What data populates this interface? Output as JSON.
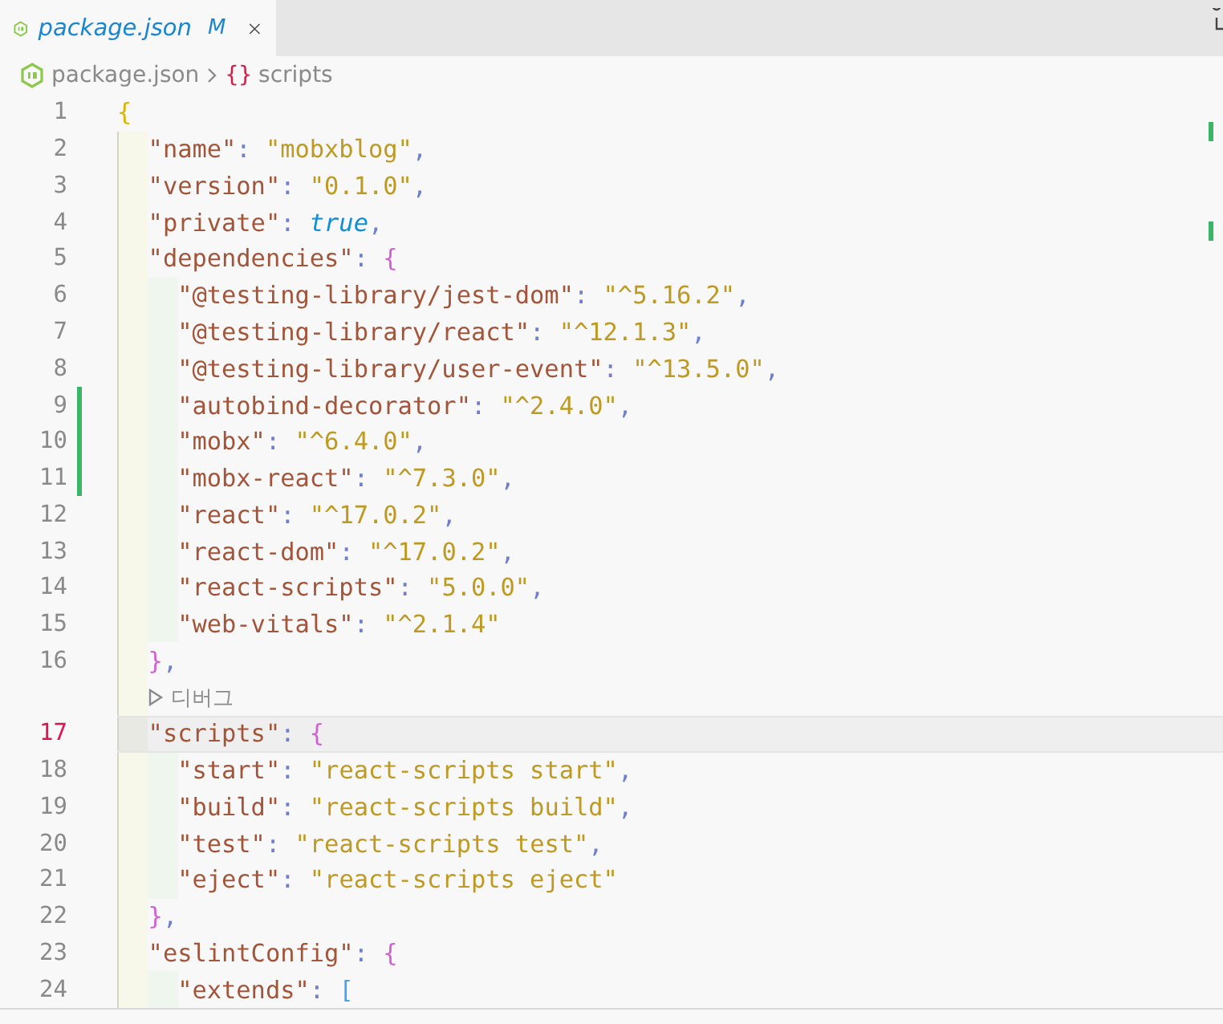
{
  "tab": {
    "title": "package.json",
    "badge": "M",
    "selected": true
  },
  "breadcrumb": {
    "file": "package.json",
    "symbol": "{}",
    "section": "scripts"
  },
  "lines": [
    {
      "kind": "code",
      "number": "1",
      "selected": false,
      "modified": false,
      "tokens": [
        {
          "kind": "bracket",
          "text": "{",
          "color": "#d9b400"
        }
      ],
      "children": [
        {
          "kind": "code",
          "number": "2",
          "selected": false,
          "modified": false,
          "tokens": [
            {
              "kind": "key",
              "text": "\"name\""
            },
            {
              "kind": "punct",
              "text": ": "
            },
            {
              "kind": "string",
              "text": "\"mobxblog\""
            },
            {
              "kind": "punct",
              "text": ","
            }
          ]
        },
        {
          "kind": "code",
          "number": "3",
          "selected": false,
          "modified": false,
          "tokens": [
            {
              "kind": "key",
              "text": "\"version\""
            },
            {
              "kind": "punct",
              "text": ": "
            },
            {
              "kind": "string",
              "text": "\"0.1.0\""
            },
            {
              "kind": "punct",
              "text": ","
            }
          ]
        },
        {
          "kind": "code",
          "number": "4",
          "selected": false,
          "modified": false,
          "tokens": [
            {
              "kind": "key",
              "text": "\"private\""
            },
            {
              "kind": "punct",
              "text": ": "
            },
            {
              "kind": "keyword",
              "text": "true"
            },
            {
              "kind": "punct",
              "text": ","
            }
          ]
        },
        {
          "kind": "code",
          "number": "5",
          "selected": false,
          "modified": false,
          "tokens": [
            {
              "kind": "key",
              "text": "\"dependencies\""
            },
            {
              "kind": "punct",
              "text": ": "
            },
            {
              "kind": "bracket",
              "text": "{",
              "color": "#d35fd3"
            }
          ],
          "children": [
            {
              "kind": "code",
              "number": "6",
              "selected": false,
              "modified": false,
              "tokens": [
                {
                  "kind": "key",
                  "text": "\"@testing-library/jest-dom\""
                },
                {
                  "kind": "punct",
                  "text": ": "
                },
                {
                  "kind": "string",
                  "text": "\"^5.16.2\""
                },
                {
                  "kind": "punct",
                  "text": ","
                }
              ]
            },
            {
              "kind": "code",
              "number": "7",
              "selected": false,
              "modified": false,
              "tokens": [
                {
                  "kind": "key",
                  "text": "\"@testing-library/react\""
                },
                {
                  "kind": "punct",
                  "text": ": "
                },
                {
                  "kind": "string",
                  "text": "\"^12.1.3\""
                },
                {
                  "kind": "punct",
                  "text": ","
                }
              ]
            },
            {
              "kind": "code",
              "number": "8",
              "selected": false,
              "modified": false,
              "tokens": [
                {
                  "kind": "key",
                  "text": "\"@testing-library/user-event\""
                },
                {
                  "kind": "punct",
                  "text": ": "
                },
                {
                  "kind": "string",
                  "text": "\"^13.5.0\""
                },
                {
                  "kind": "punct",
                  "text": ","
                }
              ]
            },
            {
              "kind": "code",
              "number": "9",
              "selected": false,
              "modified": true,
              "tokens": [
                {
                  "kind": "key",
                  "text": "\"autobind-decorator\""
                },
                {
                  "kind": "punct",
                  "text": ": "
                },
                {
                  "kind": "string",
                  "text": "\"^2.4.0\""
                },
                {
                  "kind": "punct",
                  "text": ","
                }
              ]
            },
            {
              "kind": "code",
              "number": "10",
              "selected": false,
              "modified": true,
              "tokens": [
                {
                  "kind": "key",
                  "text": "\"mobx\""
                },
                {
                  "kind": "punct",
                  "text": ": "
                },
                {
                  "kind": "string",
                  "text": "\"^6.4.0\""
                },
                {
                  "kind": "punct",
                  "text": ","
                }
              ]
            },
            {
              "kind": "code",
              "number": "11",
              "selected": false,
              "modified": true,
              "tokens": [
                {
                  "kind": "key",
                  "text": "\"mobx-react\""
                },
                {
                  "kind": "punct",
                  "text": ": "
                },
                {
                  "kind": "string",
                  "text": "\"^7.3.0\""
                },
                {
                  "kind": "punct",
                  "text": ","
                }
              ]
            },
            {
              "kind": "code",
              "number": "12",
              "selected": false,
              "modified": false,
              "tokens": [
                {
                  "kind": "key",
                  "text": "\"react\""
                },
                {
                  "kind": "punct",
                  "text": ": "
                },
                {
                  "kind": "string",
                  "text": "\"^17.0.2\""
                },
                {
                  "kind": "punct",
                  "text": ","
                }
              ]
            },
            {
              "kind": "code",
              "number": "13",
              "selected": false,
              "modified": false,
              "tokens": [
                {
                  "kind": "key",
                  "text": "\"react-dom\""
                },
                {
                  "kind": "punct",
                  "text": ": "
                },
                {
                  "kind": "string",
                  "text": "\"^17.0.2\""
                },
                {
                  "kind": "punct",
                  "text": ","
                }
              ]
            },
            {
              "kind": "code",
              "number": "14",
              "selected": false,
              "modified": false,
              "tokens": [
                {
                  "kind": "key",
                  "text": "\"react-scripts\""
                },
                {
                  "kind": "punct",
                  "text": ": "
                },
                {
                  "kind": "string",
                  "text": "\"5.0.0\""
                },
                {
                  "kind": "punct",
                  "text": ","
                }
              ]
            },
            {
              "kind": "code",
              "number": "15",
              "selected": false,
              "modified": false,
              "tokens": [
                {
                  "kind": "key",
                  "text": "\"web-vitals\""
                },
                {
                  "kind": "punct",
                  "text": ": "
                },
                {
                  "kind": "string",
                  "text": "\"^2.1.4\""
                }
              ]
            }
          ]
        },
        {
          "kind": "code",
          "number": "16",
          "selected": false,
          "modified": false,
          "tokens": [
            {
              "kind": "bracket",
              "text": "}",
              "color": "#d35fd3"
            },
            {
              "kind": "punct",
              "text": ","
            }
          ]
        },
        {
          "kind": "codelens",
          "label": "디버그"
        },
        {
          "kind": "code",
          "number": "17",
          "selected": true,
          "modified": false,
          "tokens": [
            {
              "kind": "key",
              "text": "\"scripts\""
            },
            {
              "kind": "punct",
              "text": ": "
            },
            {
              "kind": "bracket",
              "text": "{",
              "color": "#d35fd3"
            }
          ],
          "children": [
            {
              "kind": "code",
              "number": "18",
              "selected": false,
              "modified": false,
              "tokens": [
                {
                  "kind": "key",
                  "text": "\"start\""
                },
                {
                  "kind": "punct",
                  "text": ": "
                },
                {
                  "kind": "string",
                  "text": "\"react-scripts start\""
                },
                {
                  "kind": "punct",
                  "text": ","
                }
              ]
            },
            {
              "kind": "code",
              "number": "19",
              "selected": false,
              "modified": false,
              "tokens": [
                {
                  "kind": "key",
                  "text": "\"build\""
                },
                {
                  "kind": "punct",
                  "text": ": "
                },
                {
                  "kind": "string",
                  "text": "\"react-scripts build\""
                },
                {
                  "kind": "punct",
                  "text": ","
                }
              ]
            },
            {
              "kind": "code",
              "number": "20",
              "selected": false,
              "modified": false,
              "tokens": [
                {
                  "kind": "key",
                  "text": "\"test\""
                },
                {
                  "kind": "punct",
                  "text": ": "
                },
                {
                  "kind": "string",
                  "text": "\"react-scripts test\""
                },
                {
                  "kind": "punct",
                  "text": ","
                }
              ]
            },
            {
              "kind": "code",
              "number": "21",
              "selected": false,
              "modified": false,
              "tokens": [
                {
                  "kind": "key",
                  "text": "\"eject\""
                },
                {
                  "kind": "punct",
                  "text": ": "
                },
                {
                  "kind": "string",
                  "text": "\"react-scripts eject\""
                }
              ]
            }
          ]
        },
        {
          "kind": "code",
          "number": "22",
          "selected": false,
          "modified": false,
          "tokens": [
            {
              "kind": "bracket",
              "text": "}",
              "color": "#d35fd3"
            },
            {
              "kind": "punct",
              "text": ","
            }
          ]
        },
        {
          "kind": "code",
          "number": "23",
          "selected": false,
          "modified": false,
          "tokens": [
            {
              "kind": "key",
              "text": "\"eslintConfig\""
            },
            {
              "kind": "punct",
              "text": ": "
            },
            {
              "kind": "bracket",
              "text": "{",
              "color": "#d35fd3"
            }
          ],
          "children": [
            {
              "kind": "code",
              "number": "24",
              "selected": false,
              "modified": false,
              "tokens": [
                {
                  "kind": "key",
                  "text": "\"extends\""
                },
                {
                  "kind": "punct",
                  "text": ": "
                },
                {
                  "kind": "bracket",
                  "text": "[",
                  "color": "#4aa3f0"
                }
              ]
            }
          ]
        }
      ]
    }
  ]
}
